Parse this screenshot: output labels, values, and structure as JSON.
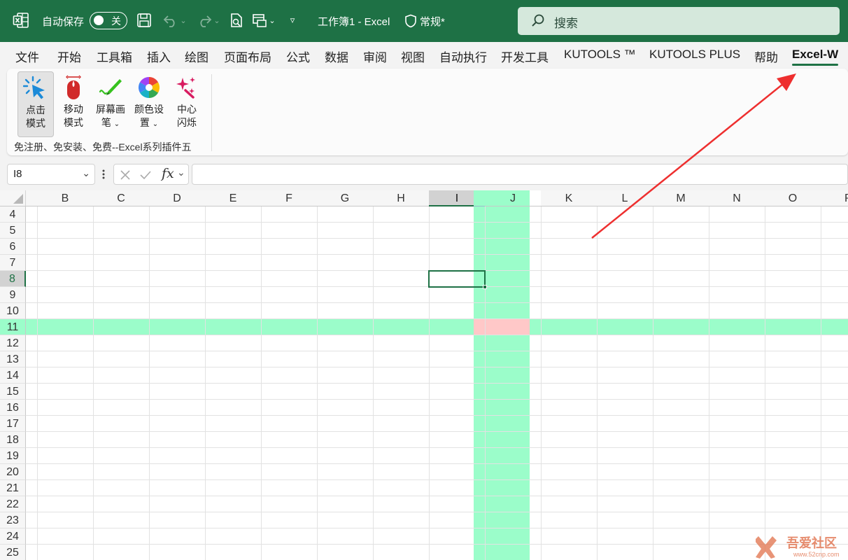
{
  "titlebar": {
    "autosave_label": "自动保存",
    "autosave_state": "关",
    "doc_title": "工作簿1 - Excel",
    "sensitivity": "常规*",
    "search_placeholder": "搜索",
    "bg_color": "#1e7145"
  },
  "menu": {
    "tabs": [
      "文件",
      "开始",
      "工具箱",
      "插入",
      "绘图",
      "页面布局",
      "公式",
      "数据",
      "审阅",
      "视图",
      "自动执行",
      "开发工具",
      "KUTOOLS ™",
      "KUTOOLS PLUS",
      "帮助",
      "Excel-W"
    ],
    "active": "Excel-W"
  },
  "ribbon": {
    "buttons": [
      {
        "line1": "点击",
        "line2": "模式",
        "icon": "click-cursor-icon",
        "selected": true
      },
      {
        "line1": "移动",
        "line2": "模式",
        "icon": "mouse-icon"
      },
      {
        "line1": "屏幕画",
        "line2": "笔",
        "icon": "pen-icon",
        "dropdown": true
      },
      {
        "line1": "颜色设",
        "line2": "置",
        "icon": "color-wheel-icon",
        "dropdown": true
      },
      {
        "line1": "中心",
        "line2": "闪烁",
        "icon": "sparkle-icon"
      }
    ],
    "group_label": "免注册、免安装、免费--Excel系列插件五"
  },
  "formula_bar": {
    "name_box": "I8",
    "fx_label": "fx",
    "formula": ""
  },
  "grid": {
    "columns": [
      "B",
      "C",
      "D",
      "E",
      "F",
      "G",
      "H",
      "I",
      "J",
      "K",
      "L",
      "M",
      "N",
      "O",
      "P"
    ],
    "rows": [
      "4",
      "5",
      "6",
      "7",
      "8",
      "9",
      "10",
      "11",
      "12",
      "13",
      "14",
      "15",
      "16",
      "17",
      "18",
      "19",
      "20",
      "21",
      "22",
      "23",
      "24",
      "25"
    ],
    "active_cell": "I8",
    "highlight_row": "11",
    "highlight_col": "J",
    "highlight_color": "#9bfdca",
    "intersection_color": "#ffc8c8"
  },
  "watermark": {
    "text": "吾爱社区",
    "url": "www.52cnp.com"
  }
}
